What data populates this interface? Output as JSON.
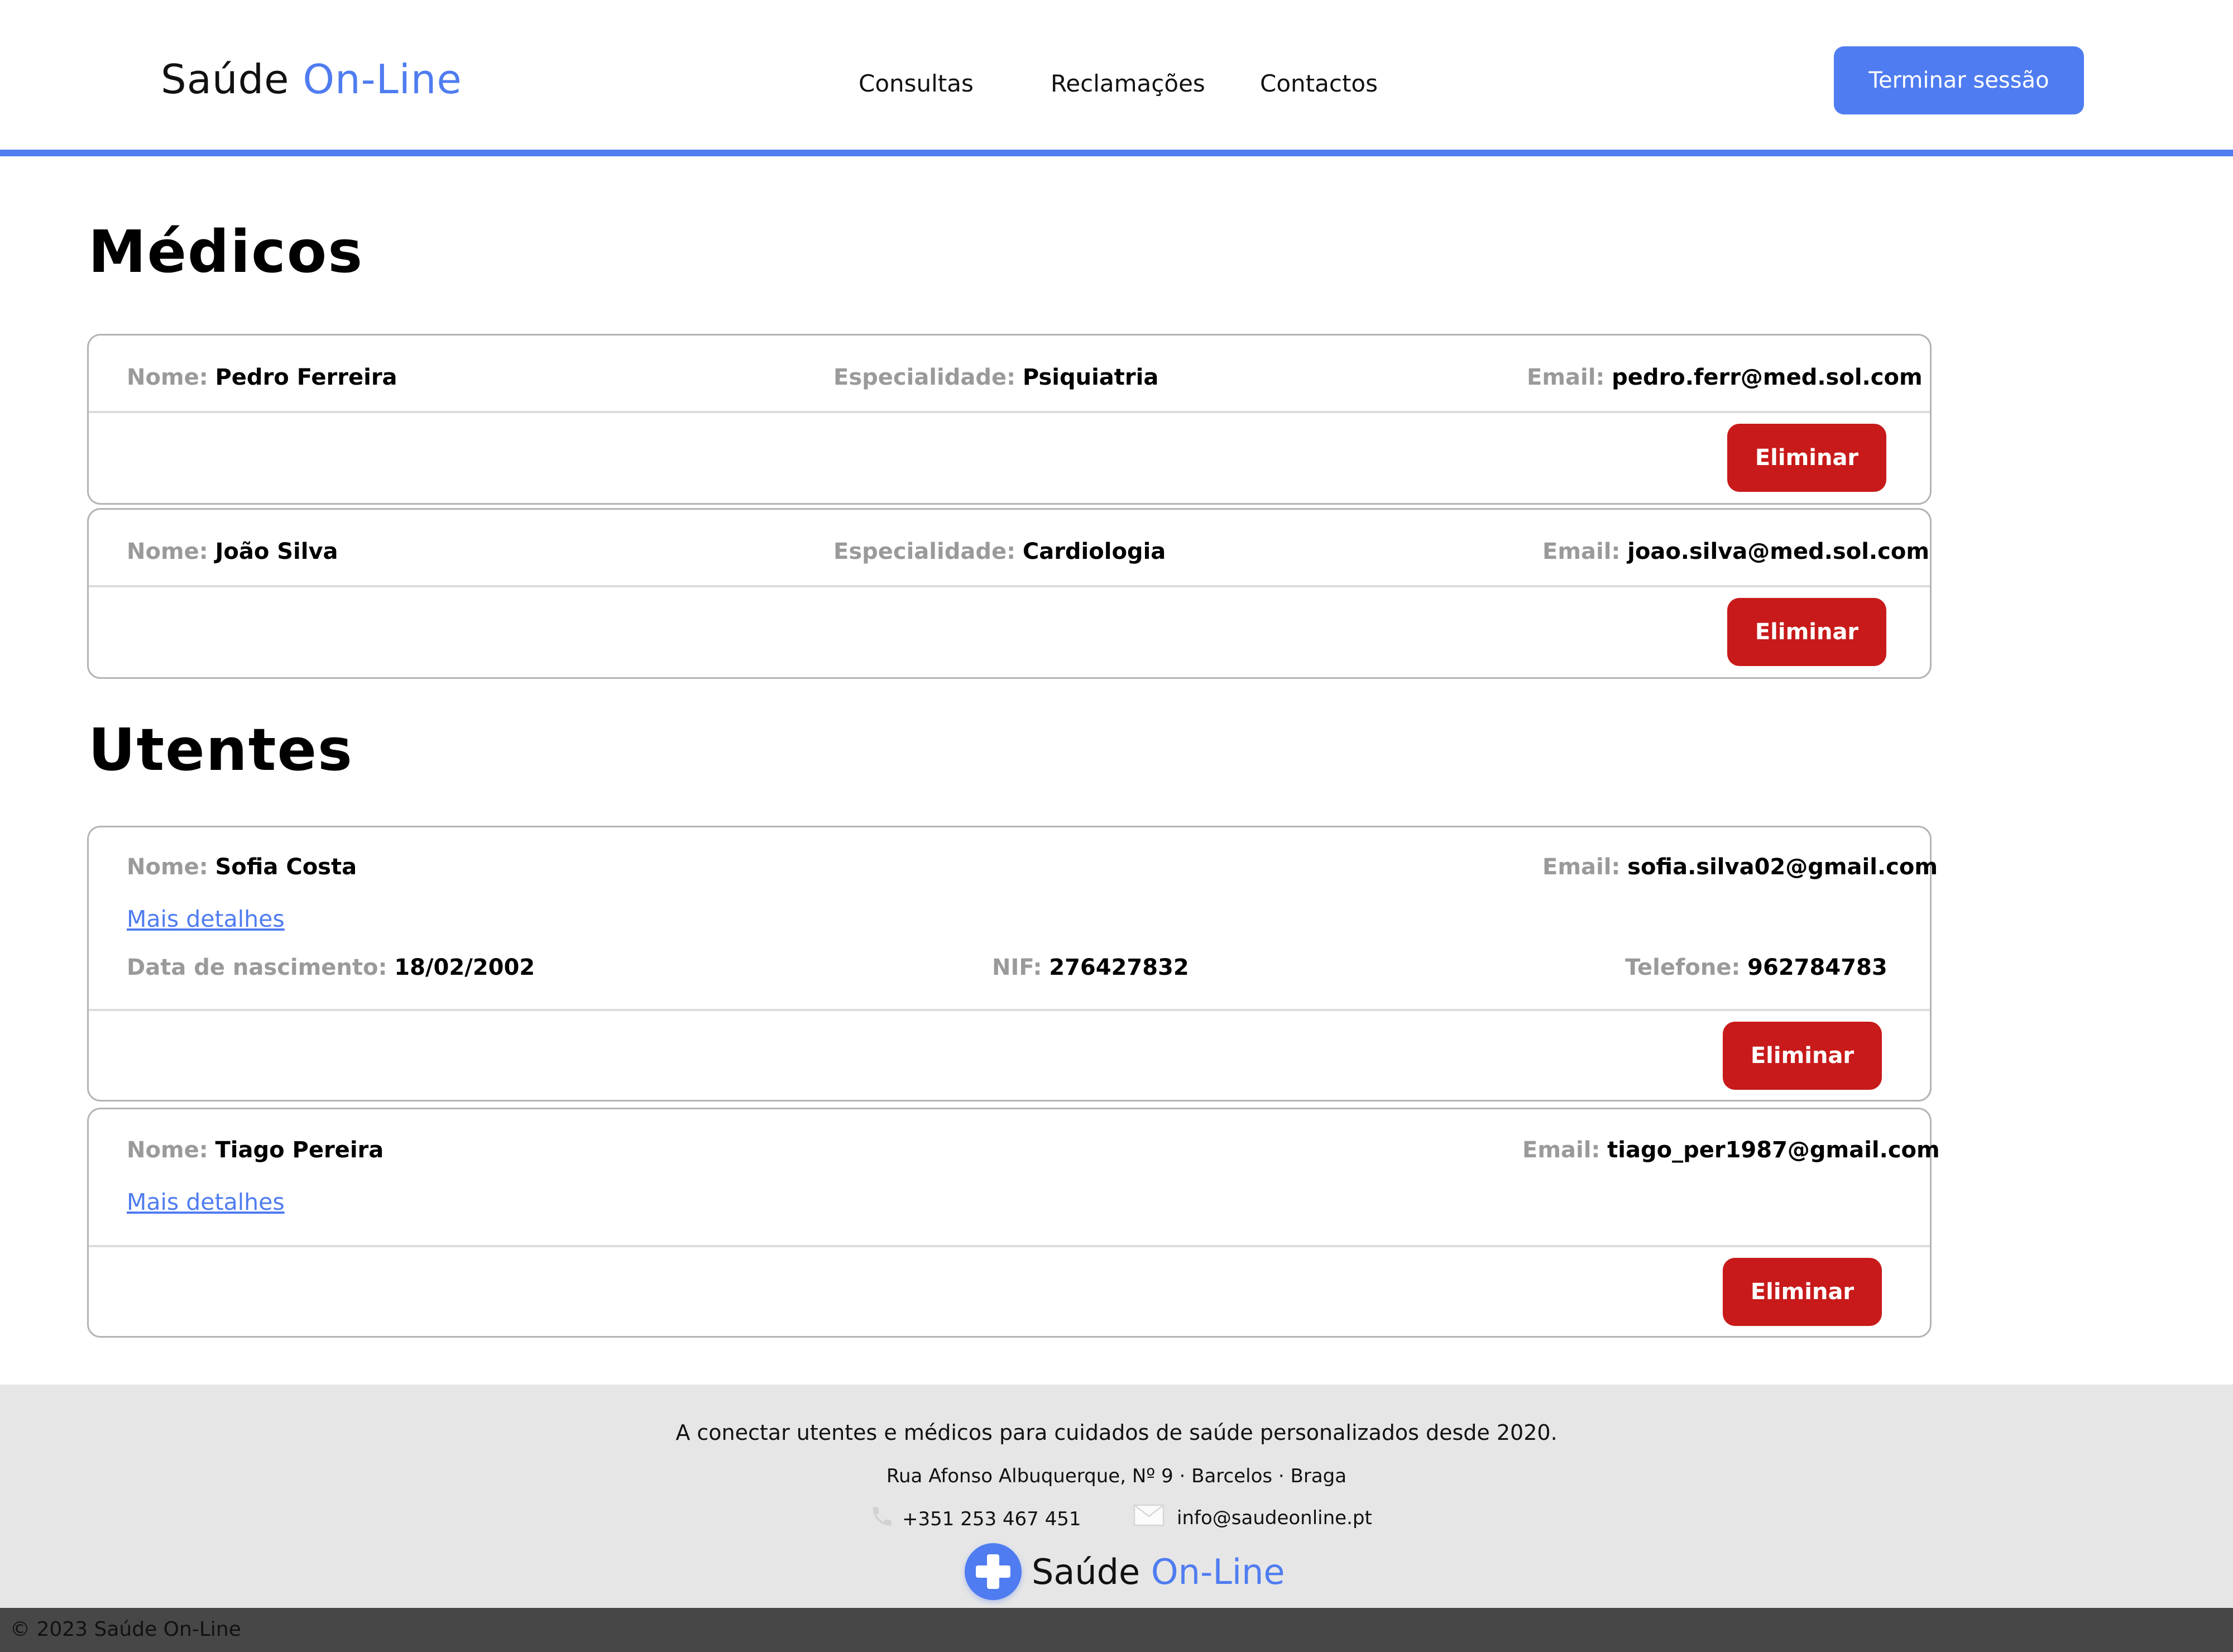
{
  "header": {
    "brand_main": "Saúde",
    "brand_accent": "On-Line",
    "nav": [
      "Consultas",
      "Reclamações",
      "Contactos"
    ],
    "logout_label": "Terminar sessão"
  },
  "colors": {
    "accent": "#4f7cf0",
    "danger": "#c81a1a",
    "footer_bg": "#e6e6e6",
    "copy_bar": "#474747"
  },
  "medicos": {
    "title": "Médicos",
    "items": [
      {
        "nome_label": "Nome:",
        "nome": "Pedro Ferreira",
        "esp_label": "Especialidade:",
        "especialidade": "Psiquiatria",
        "email_label": "Email:",
        "email": "pedro.ferr@med.sol.com",
        "action": "Eliminar"
      },
      {
        "nome_label": "Nome:",
        "nome": "João Silva",
        "esp_label": "Especialidade:",
        "especialidade": "Cardiologia",
        "email_label": "Email:",
        "email": "joao.silva@med.sol.com",
        "action": "Eliminar"
      }
    ]
  },
  "utentes": {
    "title": "Utentes",
    "items": [
      {
        "nome_label": "Nome:",
        "nome": "Sofia Costa",
        "email_label": "Email:",
        "email": "sofia.silva02@gmail.com",
        "details_link": "Mais detalhes",
        "nasc_label": "Data de nascimento:",
        "nascimento": "18/02/2002",
        "nif_label": "NIF:",
        "nif": "276427832",
        "tel_label": "Telefone:",
        "telefone": "962784783",
        "action": "Eliminar"
      },
      {
        "nome_label": "Nome:",
        "nome": "Tiago Pereira",
        "email_label": "Email:",
        "email": "tiago_per1987@gmail.com",
        "details_link": "Mais detalhes",
        "action": "Eliminar"
      }
    ]
  },
  "footer": {
    "tagline": "A conectar utentes e médicos para cuidados de saúde personalizados desde 2020.",
    "address": "Rua Afonso Albuquerque, Nº 9 · Barcelos · Braga",
    "phone": "+351 253 467 451",
    "email": "info@saudeonline.pt",
    "brand_main": "Saúde",
    "brand_accent": "On-Line",
    "icons": {
      "phone": "phone-icon",
      "email": "envelope-icon",
      "logo": "medical-cross-icon"
    },
    "copyright": "© 2023 Saúde On-Line"
  }
}
